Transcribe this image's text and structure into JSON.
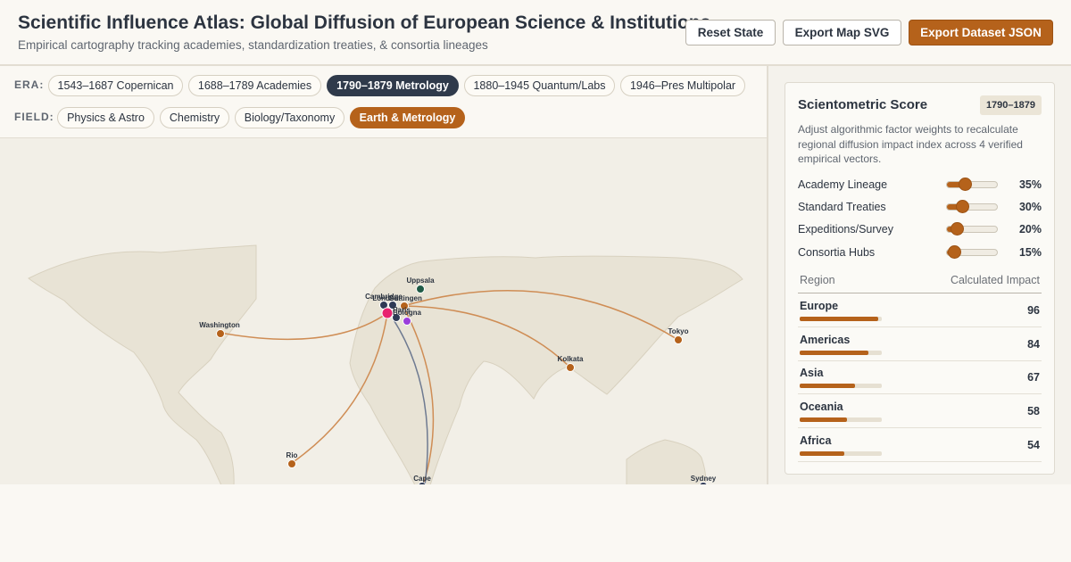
{
  "header": {
    "title": "Scientific Influence Atlas: Global Diffusion of European Science & Institutions",
    "subtitle": "Empirical cartography tracking academies, standardization treaties, & consortia lineages",
    "buttons": {
      "reset": "Reset State",
      "export_svg": "Export Map SVG",
      "export_json": "Export Dataset JSON"
    }
  },
  "filters": {
    "era_label": "ERA:",
    "eras": [
      "1543–1687 Copernican",
      "1688–1789 Academies",
      "1790–1879 Metrology",
      "1880–1945 Quantum/Labs",
      "1946–Pres Multipolar"
    ],
    "active_era": "1790–1879 Metrology",
    "field_label": "FIELD:",
    "fields": [
      "Physics & Astro",
      "Chemistry",
      "Biology/Taxonomy",
      "Earth & Metrology"
    ],
    "active_field": "Earth & Metrology"
  },
  "map": {
    "cities": [
      {
        "name": "Uppsala",
        "color": "#1f5b46"
      },
      {
        "name": "Cambridge",
        "color": "#2f3a55"
      },
      {
        "name": "London",
        "color": "#2f3a55"
      },
      {
        "name": "Göttingen",
        "color": "#b5621b"
      },
      {
        "name": "Paris",
        "color": "#e8226f"
      },
      {
        "name": "Bologna",
        "color": "#9a3ddb"
      },
      {
        "name": "Washington",
        "color": "#b5621b"
      },
      {
        "name": "Kolkata",
        "color": "#b5621b"
      },
      {
        "name": "Tokyo",
        "color": "#b5621b"
      },
      {
        "name": "Rio",
        "color": "#b5621b"
      },
      {
        "name": "Cape",
        "color": "#2f3a55"
      },
      {
        "name": "Sydney",
        "color": "#2f3a55"
      }
    ],
    "colors": {
      "land": "#e8e3d5",
      "ocean": "#f2efe7",
      "arc_primary": "#cf8d55",
      "arc_secondary": "#6e7a91"
    }
  },
  "panel": {
    "title": "Scientometric Score",
    "badge": "1790–1879",
    "description": "Adjust algorithmic factor weights to recalculate regional diffusion impact index across 4 verified empirical vectors.",
    "factors": [
      {
        "label": "Academy Lineage",
        "value": 35,
        "display": "35%"
      },
      {
        "label": "Standard Treaties",
        "value": 30,
        "display": "30%"
      },
      {
        "label": "Expeditions/Survey",
        "value": 20,
        "display": "20%"
      },
      {
        "label": "Consortia Hubs",
        "value": 15,
        "display": "15%"
      }
    ],
    "table_headers": {
      "region": "Region",
      "impact": "Calculated Impact"
    },
    "regions": [
      {
        "name": "Europe",
        "impact": 96,
        "display": "96"
      },
      {
        "name": "Americas",
        "impact": 84,
        "display": "84"
      },
      {
        "name": "Asia",
        "impact": 67,
        "display": "67"
      },
      {
        "name": "Oceania",
        "impact": 58,
        "display": "58"
      },
      {
        "name": "Africa",
        "impact": 54,
        "display": "54"
      }
    ],
    "accent": "#b5621b"
  }
}
